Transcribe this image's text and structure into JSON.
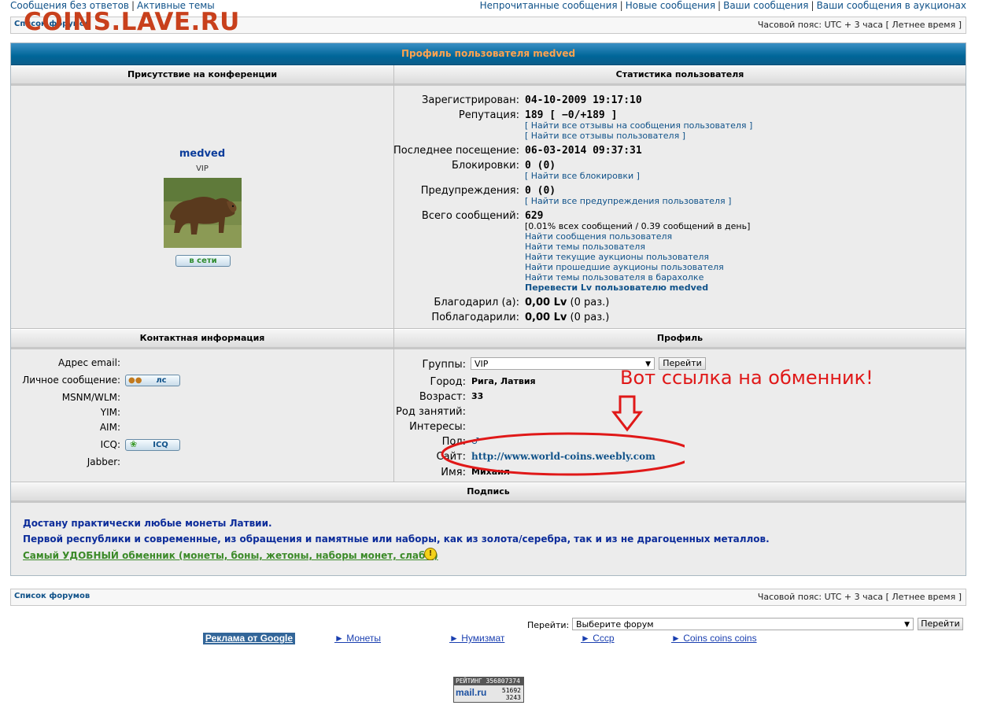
{
  "top_links": {
    "left": [
      "Сообщения без ответов",
      "Активные темы"
    ],
    "right": [
      "Непрочитанные сообщения",
      "Новые сообщения",
      "Ваши сообщения",
      "Ваши сообщения в аукционах"
    ]
  },
  "watermark": "COINS.LAVE.RU",
  "breadcrumb": {
    "label": "Список форумов",
    "timezone": "Часовой пояс: UTC + 3 часа [ Летнее время ]"
  },
  "profile_title": "Профиль пользователя medved",
  "sections": {
    "presence": "Присутствие на конференции",
    "stats": "Статистика пользователя",
    "contact": "Контактная информация",
    "profile": "Профиль",
    "signature": "Подпись"
  },
  "user": {
    "name": "medved",
    "rank": "VIP",
    "online": "в сети"
  },
  "stats": {
    "registered_label": "Зарегистрирован:",
    "registered": "04-10-2009 19:17:10",
    "reputation_label": "Репутация:",
    "reputation": "189 [ −0/+189 ]",
    "rep_link1": "[ Найти все отзывы на сообщения пользователя ]",
    "rep_link2": "[ Найти все отзывы пользователя ]",
    "last_visit_label": "Последнее посещение:",
    "last_visit": "06-03-2014 09:37:31",
    "bans_label": "Блокировки:",
    "bans": "0 (0)",
    "bans_link": "[ Найти все блокировки ]",
    "warnings_label": "Предупреждения:",
    "warnings": "0 (0)",
    "warnings_link": "[ Найти все предупреждения пользователя ]",
    "posts_label": "Всего сообщений:",
    "posts": "629",
    "posts_share": "[0.01% всех сообщений / 0.39 сообщений в день]",
    "links": [
      "Найти сообщения пользователя",
      "Найти темы пользователя",
      "Найти текущие аукционы пользователя",
      "Найти прошедшие аукционы пользователя",
      "Найти темы пользователя в барахолке"
    ],
    "transfer_link": "Перевести Lv пользователю medved",
    "thanked_label": "Благодарил (а):",
    "thanked_value": "0,00 Lv",
    "thanked_count": "(0 раз.)",
    "got_thanks_label": "Поблагодарили:",
    "got_thanks_value": "0,00 Lv",
    "got_thanks_count": "(0 раз.)"
  },
  "contact": {
    "email_label": "Адрес email:",
    "pm_label": "Личное сообщение:",
    "pm_button": "лс",
    "msn_label": "MSNM/WLM:",
    "yim_label": "YIM:",
    "aim_label": "AIM:",
    "icq_label": "ICQ:",
    "icq_button": "ICQ",
    "jabber_label": "Jabber:"
  },
  "profile": {
    "groups_label": "Группы:",
    "groups_value": "VIP",
    "go_button": "Перейти",
    "city_label": "Город:",
    "city": "Рига, Латвия",
    "age_label": "Возраст:",
    "age": "33",
    "occupation_label": "Род занятий:",
    "interests_label": "Интересы:",
    "gender_label": "Пол:",
    "site_label": "Сайт:",
    "site": "http://www.world-coins.weebly.com",
    "name_label": "Имя:",
    "name": "Михаил"
  },
  "annotation": "Вот ссылка на обменник!",
  "signature": {
    "line1": "Достану практически любые монеты Латвии.",
    "line2": "Первой республики и современные, из обращения и памятные или наборы, как из золота/серебра, так и из не драгоценных металлов.",
    "line3": "Самый УДОБНЫЙ обменник (монеты, боны, жетоны, наборы монет, слабы)"
  },
  "footer": {
    "jump_label": "Перейти:",
    "jump_select": "Выберите форум",
    "jump_button": "Перейти",
    "ad_label": "Реклама от Google",
    "ads": [
      "► Монеты",
      "► Нумизмат",
      "► Ссср",
      "► Coins coins coins"
    ],
    "counter_top": "РЕЙТИНГ 356807374",
    "counter_brand": "mail.ru",
    "counter_n1": "51692",
    "counter_n2": "3243"
  },
  "colors": {
    "header_blue": "#006699",
    "title_orange": "#ffa34f",
    "link": "#105289",
    "annotation_red": "#e01818"
  }
}
